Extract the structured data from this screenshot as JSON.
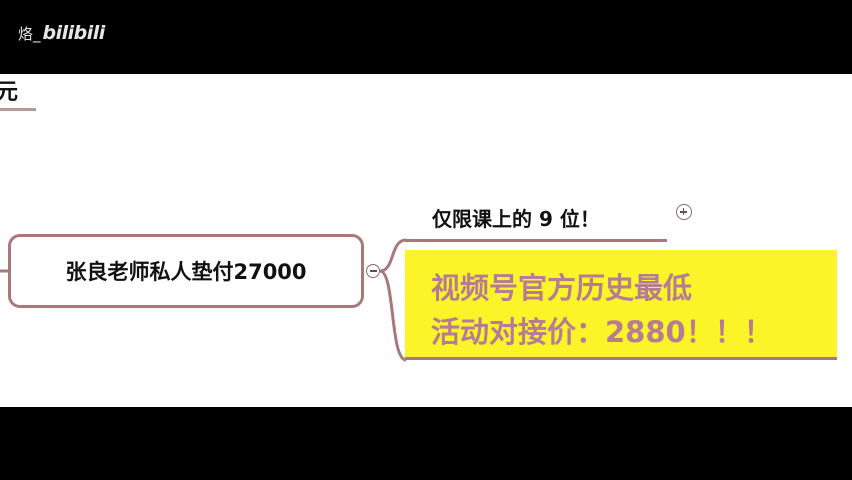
{
  "watermark": {
    "user": "烙_",
    "logo": "bilibili"
  },
  "canvas": {
    "heading_fragment": "元",
    "main_node": {
      "label": "张良老师私人垫付27000"
    },
    "branch": {
      "label": "仅限课上的 9 位！"
    },
    "highlight": {
      "line1": "视频号官方历史最低",
      "line2": "活动对接价：2880！！！"
    }
  },
  "colors": {
    "background": "#ffffff",
    "letterbox": "#000000",
    "node_border": "#a8787a",
    "highlight_bg": "#fbf429",
    "highlight_text": "#b67c93"
  },
  "icons": {
    "collapse": "minus-circle-icon",
    "expand": "plus-circle-icon"
  }
}
